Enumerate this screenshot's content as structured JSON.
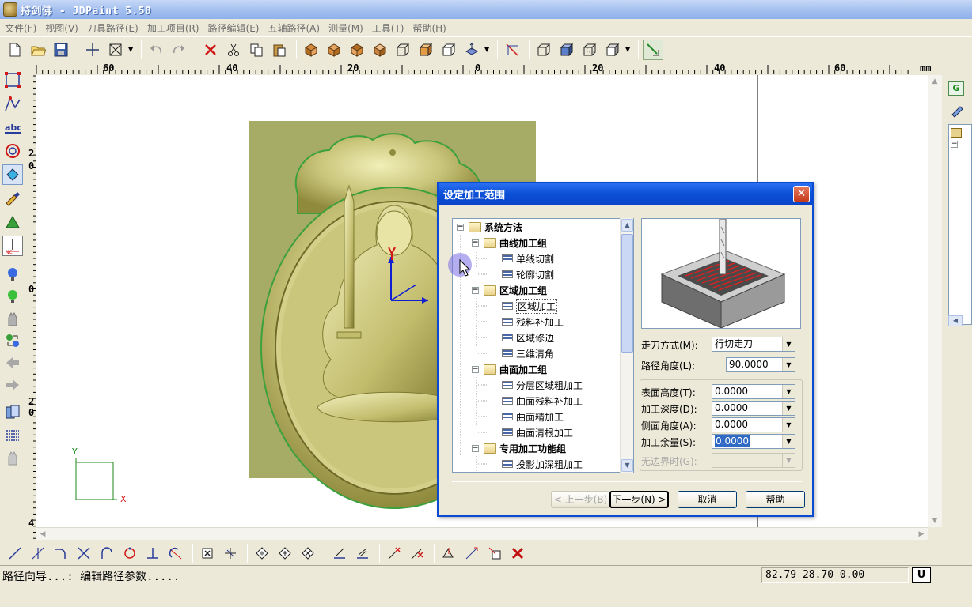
{
  "window": {
    "title": "持剑佛 - JDPaint 5.50"
  },
  "menu": {
    "items": [
      "文件(F)",
      "视图(V)",
      "刀具路径(E)",
      "加工项目(R)",
      "路径编辑(E)",
      "五轴路径(A)",
      "测量(M)",
      "工具(T)",
      "帮助(H)"
    ]
  },
  "ruler": {
    "unit": "mm",
    "h_labels": [
      "60",
      "40",
      "20",
      "0",
      "20",
      "40",
      "60"
    ],
    "v_labels": [
      "2",
      "0",
      "0",
      "2",
      "0",
      "4"
    ]
  },
  "axes": {
    "x": "X",
    "y": "Y"
  },
  "dialog": {
    "title": "设定加工范围",
    "tree": [
      {
        "label": "系统方法",
        "level": 0,
        "kind": "group"
      },
      {
        "label": "曲线加工组",
        "level": 1,
        "kind": "group"
      },
      {
        "label": "单线切割",
        "level": 2,
        "kind": "leaf"
      },
      {
        "label": "轮廓切割",
        "level": 2,
        "kind": "leaf"
      },
      {
        "label": "区域加工组",
        "level": 1,
        "kind": "group"
      },
      {
        "label": "区域加工",
        "level": 2,
        "kind": "leaf"
      },
      {
        "label": "残料补加工",
        "level": 2,
        "kind": "leaf"
      },
      {
        "label": "区域修边",
        "level": 2,
        "kind": "leaf"
      },
      {
        "label": "三维清角",
        "level": 2,
        "kind": "leaf"
      },
      {
        "label": "曲面加工组",
        "level": 1,
        "kind": "group"
      },
      {
        "label": "分层区域粗加工",
        "level": 2,
        "kind": "leaf"
      },
      {
        "label": "曲面残料补加工",
        "level": 2,
        "kind": "leaf"
      },
      {
        "label": "曲面精加工",
        "level": 2,
        "kind": "leaf"
      },
      {
        "label": "曲面清根加工",
        "level": 2,
        "kind": "leaf"
      },
      {
        "label": "专用加工功能组",
        "level": 1,
        "kind": "group"
      },
      {
        "label": "投影加深粗加工",
        "level": 2,
        "kind": "leaf"
      }
    ],
    "fields": {
      "walk_mode": {
        "label": "走刀方式(M):",
        "value": "行切走刀"
      },
      "path_angle": {
        "label": "路径角度(L):",
        "value": "90.0000"
      },
      "surface_height": {
        "label": "表面高度(T):",
        "value": "0.0000"
      },
      "cut_depth": {
        "label": "加工深度(D):",
        "value": "0.0000"
      },
      "side_angle": {
        "label": "侧面角度(A):",
        "value": "0.0000"
      },
      "allowance": {
        "label": "加工余量(S):",
        "value": "0.0000"
      },
      "no_boundary": {
        "label": "无边界时(G):",
        "value": ""
      }
    },
    "buttons": {
      "prev": "< 上一步(B)",
      "next": "下一步(N) >",
      "cancel": "取消",
      "help": "帮助"
    }
  },
  "status": {
    "message": "路径向导...: 编辑路径参数.....",
    "coords": "82.79 28.70 0.00",
    "unit_button": "U"
  },
  "colors": {
    "accent": "#0a4bd4",
    "relief": "#b8b86a",
    "background_panel": "#a6ab66"
  }
}
